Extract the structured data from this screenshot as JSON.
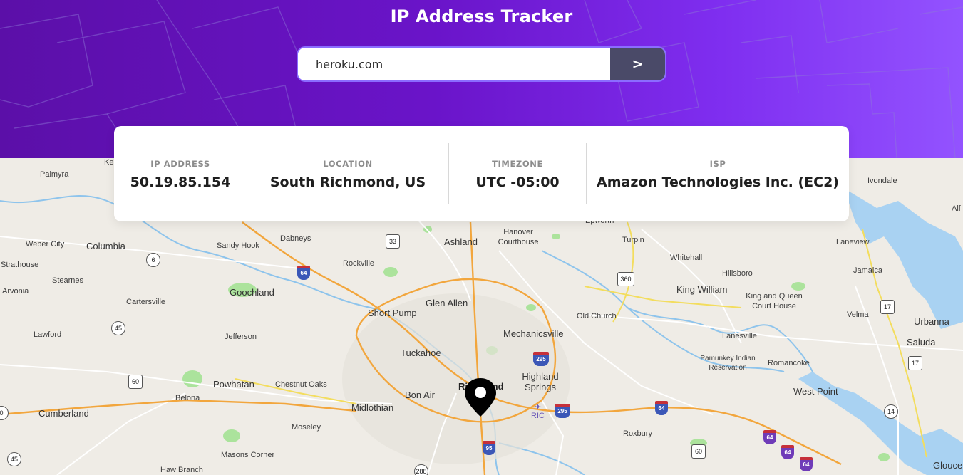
{
  "header": {
    "title": "IP Address Tracker",
    "search_value": "heroku.com",
    "search_button": ">"
  },
  "info": [
    {
      "label": "IP ADDRESS",
      "value": "50.19.85.154"
    },
    {
      "label": "LOCATION",
      "value": "South Richmond, US"
    },
    {
      "label": "TIMEZONE",
      "value": "UTC -05:00"
    },
    {
      "label": "ISP",
      "value": "Amazon Technologies Inc. (EC2)"
    }
  ],
  "map": {
    "places": {
      "palmyra": "Palmyra",
      "ke": "Ke",
      "weber_city": "Weber City",
      "columbia": "Columbia",
      "strathouse": "Strathouse",
      "stearnes": "Stearnes",
      "arvonia": "Arvonia",
      "cartersville": "Cartersville",
      "goochland": "Goochland",
      "lawford": "Lawford",
      "jefferson": "Jefferson",
      "powhatan": "Powhatan",
      "belona": "Belona",
      "chestnut_oaks": "Chestnut Oaks",
      "cumberland": "Cumberland",
      "moseley": "Moseley",
      "masons_corner": "Masons Corner",
      "haw_branch": "Haw Branch",
      "sandy_hook": "Sandy Hook",
      "dabneys": "Dabneys",
      "rockville": "Rockville",
      "ashland": "Ashland",
      "hanover_courthouse": "Hanover Courthouse",
      "epworth": "Epworth",
      "turpin": "Turpin",
      "whitehall": "Whitehall",
      "hillsboro": "Hillsboro",
      "king_william": "King William",
      "king_and_queen": "King and Queen Court House",
      "ivondale": "Ivondale",
      "alf": "Alf",
      "laneview": "Laneview",
      "jamaica": "Jamaica",
      "velma": "Velma",
      "urbanna": "Urbanna",
      "saluda": "Saluda",
      "short_pump": "Short Pump",
      "glen_allen": "Glen Allen",
      "old_church": "Old Church",
      "mechanicsville": "Mechanicsville",
      "tuckahoe": "Tuckahoe",
      "lanesville": "Lanesville",
      "pamunkey": "Pamunkey Indian Reservation",
      "romancoke": "Romancoke",
      "highland_springs": "Highland Springs",
      "richmond": "Richmond",
      "bon_air": "Bon Air",
      "midlothian": "Midlothian",
      "west_point": "West Point",
      "roxbury": "Roxbury",
      "gloucester": "Glouce"
    },
    "shields": {
      "us33": "33",
      "va6": "6",
      "us360": "360",
      "us45": "45",
      "us60": "60",
      "us60b": "60",
      "va17": "17",
      "va17b": "17",
      "va14": "14",
      "us288": "288",
      "va45": "45",
      "va0": "0"
    },
    "interstates": {
      "i64a": "64",
      "i295a": "295",
      "i295b": "295",
      "i64b": "64",
      "i64c": "64",
      "i64d": "64",
      "i64e": "64",
      "i95": "95"
    },
    "airport": "RIC"
  }
}
